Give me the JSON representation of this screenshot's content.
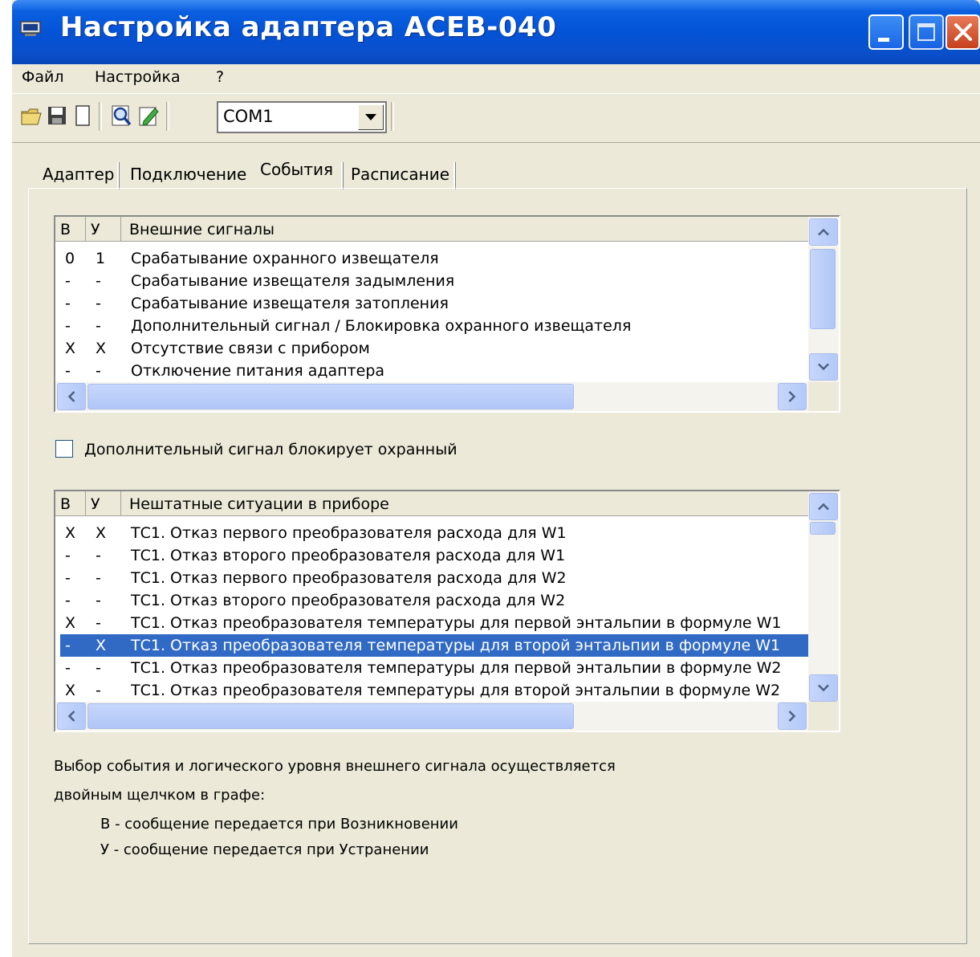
{
  "window": {
    "title": "Настройка адаптера ACEB-040"
  },
  "menu": [
    "Файл",
    "Настройка",
    "?"
  ],
  "toolbar": {
    "port": "COM1"
  },
  "tabs": [
    "Адаптер",
    "Подключение",
    "События",
    "Расписание"
  ],
  "external": {
    "headers": [
      "В",
      "У",
      "Внешние сигналы"
    ],
    "rows": [
      {
        "v": "0",
        "u": "1",
        "text": "Срабатывание охранного извещателя"
      },
      {
        "v": "-",
        "u": "-",
        "text": "Срабатывание извещателя задымления"
      },
      {
        "v": "-",
        "u": "-",
        "text": "Срабатывание извещателя затопления"
      },
      {
        "v": "-",
        "u": "-",
        "text": "Дополнительный сигнал / Блокировка охранного извещателя"
      },
      {
        "v": "X",
        "u": "X",
        "text": "Отсутствие связи с прибором"
      },
      {
        "v": "-",
        "u": "-",
        "text": "Отключение питания адаптера"
      }
    ]
  },
  "checkbox": {
    "label": "Дополнительный сигнал блокирует охранный",
    "checked": false
  },
  "faults": {
    "headers": [
      "В",
      "У",
      "Нештатные ситуации в приборе"
    ],
    "rows": [
      {
        "v": "X",
        "u": "X",
        "text": "ТС1. Отказ первого преобразователя расхода для W1"
      },
      {
        "v": "-",
        "u": "-",
        "text": "ТС1. Отказ второго преобразователя расхода для W1"
      },
      {
        "v": "-",
        "u": "-",
        "text": "ТС1. Отказ первого преобразователя расхода для W2"
      },
      {
        "v": "-",
        "u": "-",
        "text": "ТС1. Отказ второго преобразователя расхода для W2"
      },
      {
        "v": "X",
        "u": "-",
        "text": "ТС1. Отказ преобразователя температуры для первой энтальпии в формуле W1"
      },
      {
        "v": "-",
        "u": "X",
        "text": "ТС1. Отказ преобразователя температуры для второй энтальпии в формуле W1",
        "selected": true
      },
      {
        "v": "-",
        "u": "-",
        "text": "ТС1. Отказ преобразователя температуры для первой энтальпии в формуле W2"
      },
      {
        "v": "X",
        "u": "-",
        "text": "ТС1. Отказ преобразователя температуры для второй энтальпии в формуле W2"
      }
    ]
  },
  "help": {
    "line1": "Выбор события и логического уровня внешнего сигнала осуществляется",
    "line2": "двойным щелчком в графе:",
    "line3": "В - сообщение передается при Возникновении",
    "line4": "У - сообщение передается при Устранении"
  }
}
